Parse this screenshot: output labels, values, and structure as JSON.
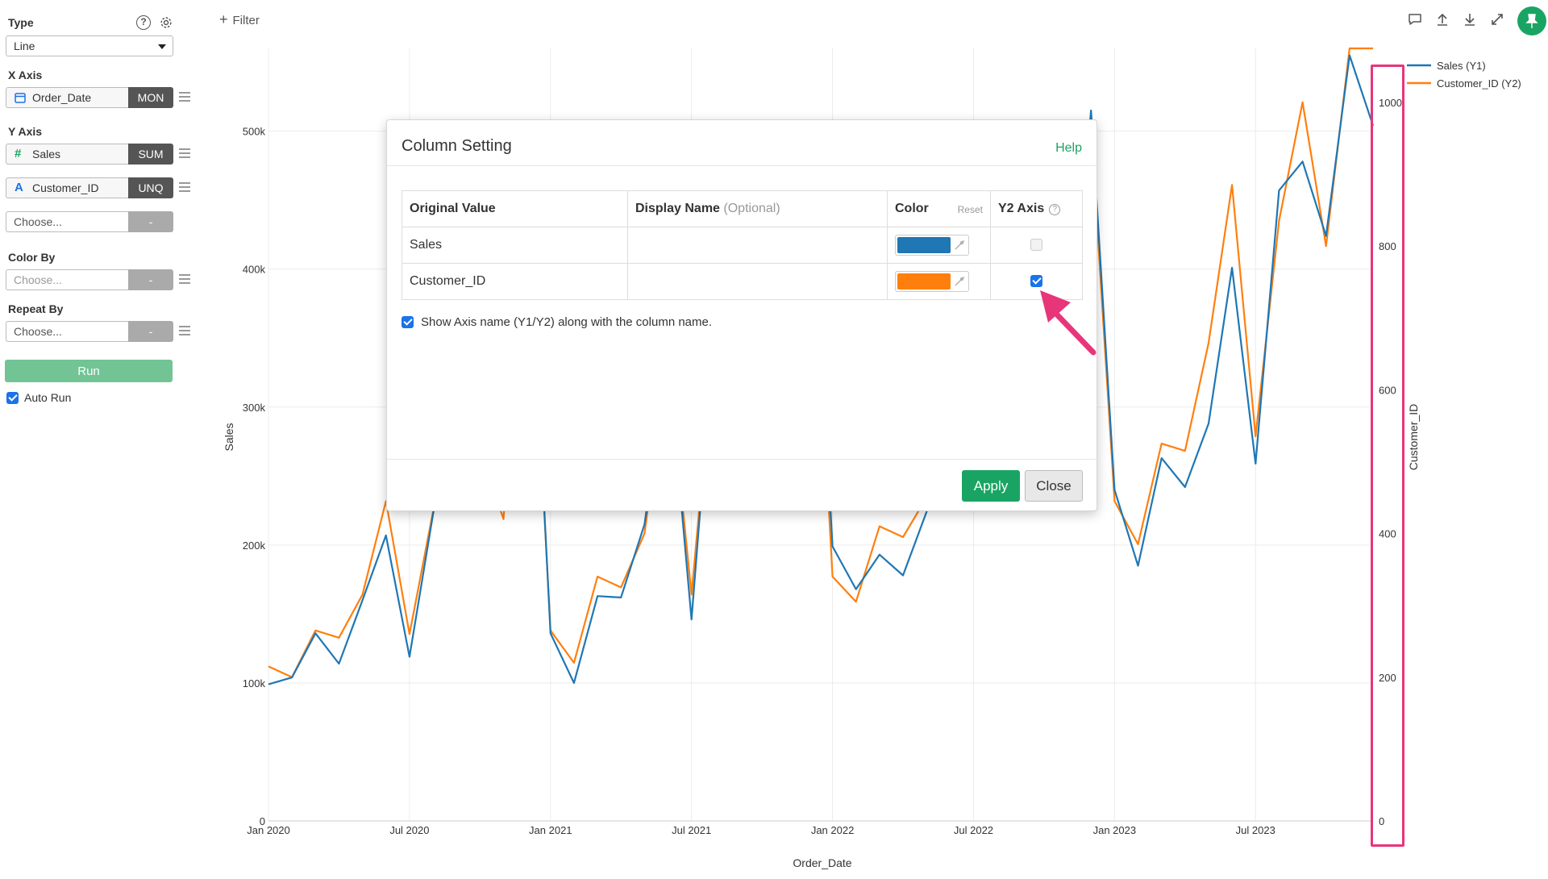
{
  "sidebar": {
    "type_label": "Type",
    "type_value": "Line",
    "x_axis_label": "X Axis",
    "x_field": {
      "name": "Order_Date",
      "agg": "MON"
    },
    "y_axis_label": "Y Axis",
    "y_fields": [
      {
        "name": "Sales",
        "agg": "SUM",
        "icon": "#"
      },
      {
        "name": "Customer_ID",
        "agg": "UNQ",
        "icon": "A"
      }
    ],
    "y_choose": {
      "placeholder": "Choose...",
      "agg": "-"
    },
    "color_by_label": "Color By",
    "color_by": {
      "placeholder": "Choose...",
      "agg": "-"
    },
    "repeat_by_label": "Repeat By",
    "repeat_by": {
      "placeholder": "Choose...",
      "agg": "-"
    },
    "run_label": "Run",
    "auto_run_label": "Auto Run"
  },
  "toolbar": {
    "filter_label": "Filter"
  },
  "dialog": {
    "title": "Column Setting",
    "help_label": "Help",
    "headers": {
      "original": "Original Value",
      "display": "Display Name",
      "display_optional": "(Optional)",
      "color": "Color",
      "reset": "Reset",
      "y2": "Y2 Axis"
    },
    "rows": [
      {
        "original": "Sales",
        "display": "",
        "color": "#1f77b4",
        "y2": false
      },
      {
        "original": "Customer_ID",
        "display": "",
        "color": "#ff7f0e",
        "y2": true
      }
    ],
    "show_axis_label": "Show Axis name (Y1/Y2) along with the column name.",
    "apply_label": "Apply",
    "close_label": "Close"
  },
  "chart_data": {
    "type": "line",
    "xlabel": "Order_Date",
    "ylabel": "Sales",
    "y2label": "Customer_ID",
    "x_ticks": [
      "Jan 2020",
      "Jul 2020",
      "Jan 2021",
      "Jul 2021",
      "Jan 2022",
      "Jul 2022",
      "Jan 2023",
      "Jul 2023"
    ],
    "y_ticks": [
      "0",
      "100k",
      "200k",
      "300k",
      "400k",
      "500k"
    ],
    "y2_ticks": [
      "0",
      "200",
      "400",
      "600",
      "800",
      "1000"
    ],
    "ylim": [
      0,
      560000
    ],
    "y2lim": [
      0,
      1075
    ],
    "grid": true,
    "legend_position": "top-right",
    "x": [
      "2020-01",
      "2020-02",
      "2020-03",
      "2020-04",
      "2020-05",
      "2020-06",
      "2020-07",
      "2020-08",
      "2020-09",
      "2020-10",
      "2020-11",
      "2020-12",
      "2021-01",
      "2021-02",
      "2021-03",
      "2021-04",
      "2021-05",
      "2021-06",
      "2021-07",
      "2021-08",
      "2021-09",
      "2021-10",
      "2021-11",
      "2021-12",
      "2022-01",
      "2022-02",
      "2022-03",
      "2022-04",
      "2022-05",
      "2022-06",
      "2022-07",
      "2022-08",
      "2022-09",
      "2022-10",
      "2022-11",
      "2022-12",
      "2023-01",
      "2023-02",
      "2023-03",
      "2023-04",
      "2023-05",
      "2023-06",
      "2023-07",
      "2023-08",
      "2023-09",
      "2023-10",
      "2023-11",
      "2023-12"
    ],
    "series": [
      {
        "name": "Sales (Y1)",
        "axis": "y1",
        "color": "#1f77b4",
        "values": [
          99000,
          104000,
          136000,
          114000,
          160000,
          207000,
          119000,
          222000,
          316000,
          263000,
          225000,
          475000,
          136000,
          100000,
          163000,
          162000,
          215000,
          338000,
          146000,
          361000,
          318000,
          236000,
          290000,
          508000,
          199000,
          168000,
          193000,
          178000,
          224000,
          324000,
          255000,
          313000,
          267000,
          380000,
          310000,
          515000,
          240000,
          185000,
          263000,
          242000,
          288000,
          401000,
          259000,
          457000,
          478000,
          424000,
          555000,
          504000
        ]
      },
      {
        "name": "Customer_ID (Y2)",
        "axis": "y2",
        "color": "#ff7f0e",
        "values": [
          215,
          200,
          265,
          255,
          315,
          445,
          260,
          430,
          600,
          515,
          420,
          890,
          265,
          220,
          340,
          325,
          400,
          640,
          315,
          675,
          600,
          455,
          555,
          945,
          340,
          305,
          410,
          395,
          450,
          635,
          450,
          595,
          520,
          720,
          600,
          965,
          445,
          385,
          525,
          515,
          665,
          885,
          535,
          835,
          1000,
          800,
          1075,
          1075
        ]
      }
    ]
  }
}
